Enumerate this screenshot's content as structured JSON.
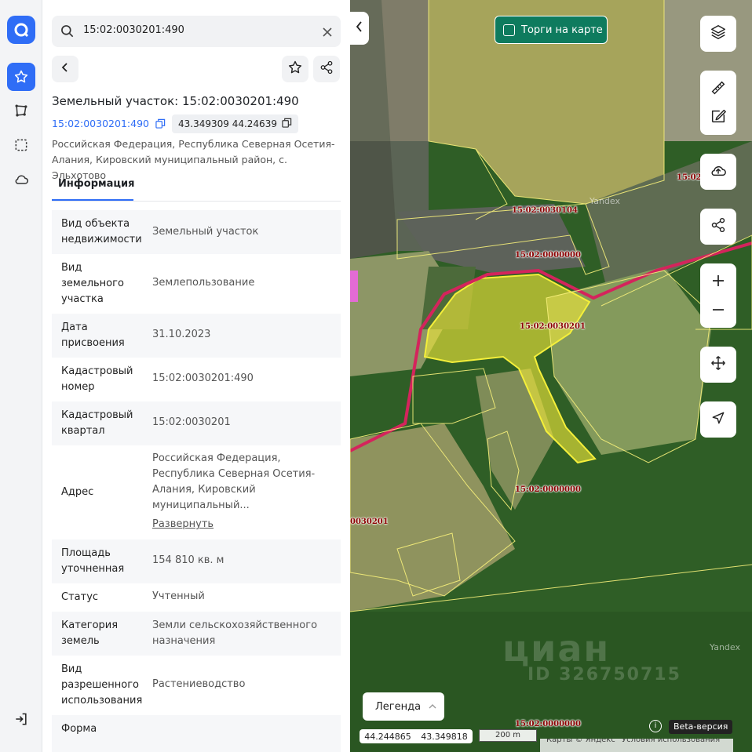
{
  "search": {
    "query": "15:02:0030201:490"
  },
  "object": {
    "title": "Земельный участок: 15:02:0030201:490",
    "cadastral_link": "15:02:0030201:490",
    "coordinates": "43.349309 44.24639",
    "address_short": "Российская Федерация, Республика Северная Осетия-Алания, Кировский муниципальный район, с. Эльхотово"
  },
  "tabs": [
    {
      "label": "Информация"
    }
  ],
  "info_rows": [
    {
      "label": "Вид объекта недвижимости",
      "value": "Земельный участок"
    },
    {
      "label": "Вид земельного участка",
      "value": "Землепользование"
    },
    {
      "label": "Дата присвоения",
      "value": "31.10.2023"
    },
    {
      "label": "Кадастровый номер",
      "value": "15:02:0030201:490"
    },
    {
      "label": "Кадастровый квартал",
      "value": "15:02:0030201"
    },
    {
      "label": "Адрес",
      "value": "Российская Федерация, Республика Северная Осетия-Алания, Кировский муниципальный...",
      "action": "Развернуть"
    },
    {
      "label": "Площадь уточненная",
      "value": "154 810 кв. м"
    },
    {
      "label": "Статус",
      "value": "Учтенный"
    },
    {
      "label": "Категория земель",
      "value": "Земли сельскохозяйственного назначения"
    },
    {
      "label": "Вид разрешенного использования",
      "value": "Растениеводство"
    },
    {
      "label": "Форма",
      "value": ""
    }
  ],
  "map": {
    "torgi_label": "Торги на карте",
    "legend_label": "Легенда",
    "coords_lon": "44.244865",
    "coords_lat": "43.349818",
    "scale_label": "200 m",
    "beta_label": "Beta-версия",
    "info_glyph": "i",
    "footer_links": [
      "Карты © Яндекс",
      "Условия использования"
    ],
    "cadastral_labels": [
      "15:02:0030104",
      "15:02:0000000",
      "15:02:0030201",
      "15:02:0000000",
      "15:02:0000000",
      "0030201",
      "15:02"
    ],
    "yandex_watermarks": [
      "Yandex",
      "Yandex"
    ],
    "cian_watermark": "циан",
    "cian_id": "ID 326750715"
  },
  "icons": [
    "logo-icon",
    "star-icon",
    "polygon-icon",
    "select-area-icon",
    "cloud-icon",
    "login-icon",
    "search-icon",
    "close-icon",
    "back-icon",
    "favorite-icon",
    "share-icon",
    "copy-icon",
    "collapse-icon",
    "layers-icon",
    "ruler-icon",
    "edit-icon",
    "upload-icon",
    "share-icon",
    "zoom-in-icon",
    "zoom-out-icon",
    "move-icon",
    "locate-icon",
    "chevron-up-icon"
  ],
  "colors": {
    "accent": "#2f6df6",
    "torgi": "#0e7b5e",
    "parcel": "#f0e838",
    "boundary": "#d4245c"
  }
}
